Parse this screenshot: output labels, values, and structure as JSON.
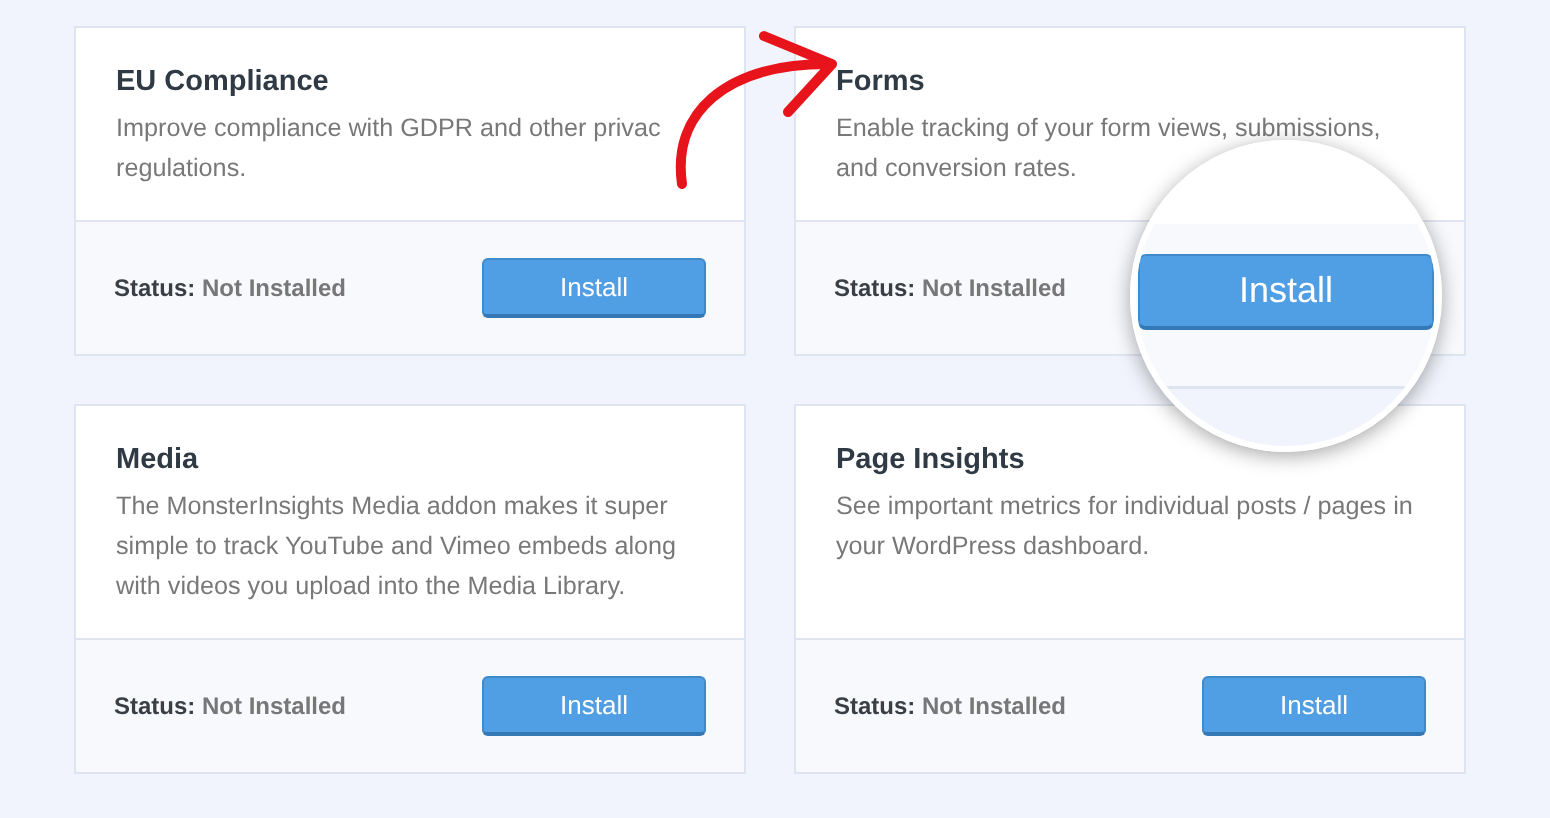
{
  "addons": [
    {
      "title": "EU Compliance",
      "description": "Improve compliance with GDPR and other privac\nregulations.",
      "status_label": "Status:",
      "status": "Not Installed",
      "button": "Install",
      "magnified": false
    },
    {
      "title": "Forms",
      "description": "Enable tracking of your form views, submissions, and conversion rates.",
      "status_label": "Status:",
      "status": "Not Installed",
      "button": "Install",
      "magnified": true
    },
    {
      "title": "Media",
      "description": "The MonsterInsights Media addon makes it super simple to track YouTube and Vimeo embeds along with videos you upload into the Media Library.",
      "status_label": "Status:",
      "status": "Not Installed",
      "button": "Install",
      "magnified": false
    },
    {
      "title": "Page Insights",
      "description": "See important metrics for individual posts / pages in your WordPress dashboard.",
      "status_label": "Status:",
      "status": "Not Installed",
      "button": "Install",
      "magnified": false
    }
  ]
}
